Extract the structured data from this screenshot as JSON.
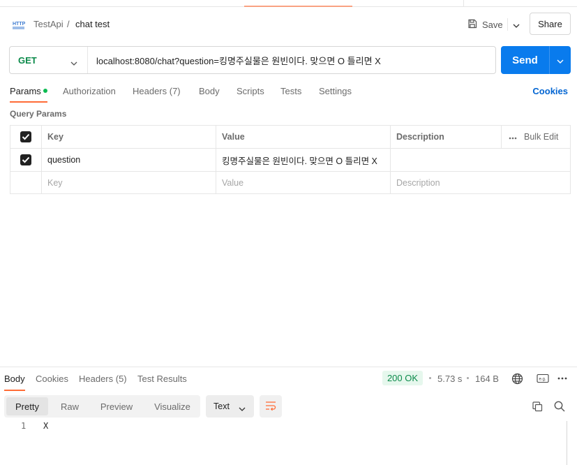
{
  "header": {
    "breadcrumb_parent": "TestApi",
    "breadcrumb_sep": "/",
    "breadcrumb_current": "chat test",
    "save_label": "Save",
    "share_label": "Share",
    "http_icon": "http-icon"
  },
  "request": {
    "method": "GET",
    "url": "localhost:8080/chat?question=킹명주실물은 원빈이다. 맞으면 O 틀리면 X",
    "send_label": "Send"
  },
  "request_tabs": {
    "params": "Params",
    "authorization": "Authorization",
    "headers": "Headers (7)",
    "body": "Body",
    "scripts": "Scripts",
    "tests": "Tests",
    "settings": "Settings",
    "cookies": "Cookies"
  },
  "query_params": {
    "title": "Query Params",
    "columns": {
      "key": "Key",
      "value": "Value",
      "description": "Description",
      "bulk_edit": "Bulk Edit"
    },
    "rows": [
      {
        "checked": true,
        "key": "question",
        "value": "킹명주실물은 원빈이다. 맞으면 O 틀리면 X",
        "description": ""
      }
    ],
    "placeholder": {
      "key": "Key",
      "value": "Value",
      "description": "Description"
    }
  },
  "response": {
    "tabs": {
      "body": "Body",
      "cookies": "Cookies",
      "headers": "Headers (5)",
      "test_results": "Test Results"
    },
    "status": "200 OK",
    "time": "5.73 s",
    "size": "164 B",
    "views": {
      "pretty": "Pretty",
      "raw": "Raw",
      "preview": "Preview",
      "visualize": "Visualize"
    },
    "format": "Text",
    "lines": [
      {
        "no": "1",
        "text": "X"
      }
    ]
  },
  "colors": {
    "accent": "#ff6c37",
    "send": "#097bed",
    "method_get": "#0b8a4a",
    "status_ok_bg": "#e6f7ed",
    "link": "#0265d2"
  }
}
